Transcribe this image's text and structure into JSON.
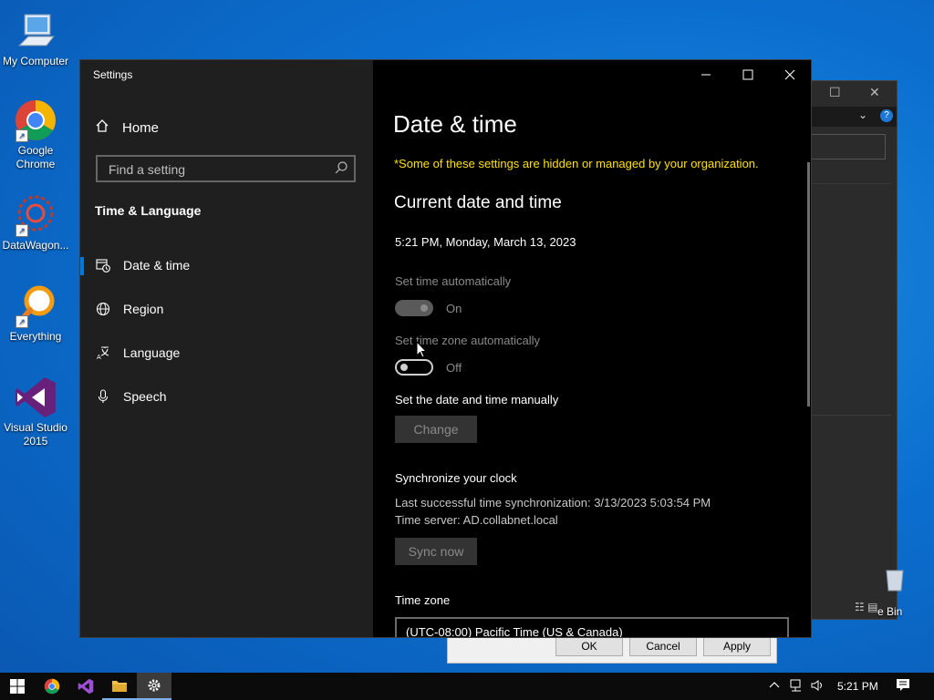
{
  "desktop": {
    "icons": [
      {
        "label": "My Computer"
      },
      {
        "label": "Google Chrome"
      },
      {
        "label": "DataWagon..."
      },
      {
        "label": "Everything"
      },
      {
        "label": "Visual Studio 2015"
      }
    ],
    "recycle_partial": "e Bin"
  },
  "dialog": {
    "ok": "OK",
    "cancel": "Cancel",
    "apply": "Apply"
  },
  "settings": {
    "window_title": "Settings",
    "home": "Home",
    "search_placeholder": "Find a setting",
    "section": "Time & Language",
    "nav": [
      {
        "label": "Date & time",
        "icon": "calendar-clock-icon",
        "active": true
      },
      {
        "label": "Region",
        "icon": "globe-icon",
        "active": false
      },
      {
        "label": "Language",
        "icon": "language-icon",
        "active": false
      },
      {
        "label": "Speech",
        "icon": "microphone-icon",
        "active": false
      }
    ],
    "content": {
      "title": "Date & time",
      "warning": "*Some of these settings are hidden or managed by your organization.",
      "current_heading": "Current date and time",
      "current_value": "5:21 PM, Monday, March 13, 2023",
      "set_time_auto_label": "Set time automatically",
      "set_time_auto_state": "On",
      "set_tz_auto_label": "Set time zone automatically",
      "set_tz_auto_state": "Off",
      "manual_label": "Set the date and time manually",
      "change_button": "Change",
      "sync_heading": "Synchronize your clock",
      "sync_last": "Last successful time synchronization: 3/13/2023 5:03:54 PM",
      "sync_server": "Time server: AD.collabnet.local",
      "sync_button": "Sync now",
      "tz_label": "Time zone",
      "tz_value": "(UTC-08:00) Pacific Time (US & Canada)"
    }
  },
  "taskbar": {
    "time": "5:21 PM"
  },
  "colors": {
    "accent": "#0078d7",
    "warning": "#ffe100"
  }
}
